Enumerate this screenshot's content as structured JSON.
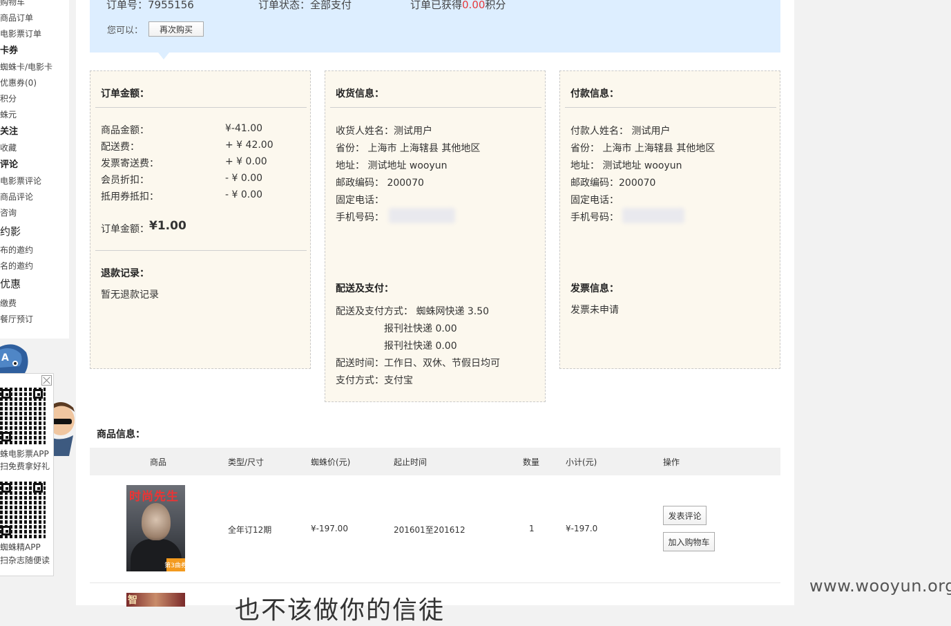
{
  "sidebar": {
    "items": [
      {
        "label": "购物车",
        "type": "item"
      },
      {
        "label": "商品订单",
        "type": "item"
      },
      {
        "label": "电影票订单",
        "type": "item"
      },
      {
        "label": "卡券",
        "type": "head"
      },
      {
        "label": "蜘蛛卡/电影卡",
        "type": "item"
      },
      {
        "label": "优惠券(0)",
        "type": "item"
      },
      {
        "label": "积分",
        "type": "item"
      },
      {
        "label": "蛛元",
        "type": "item"
      },
      {
        "label": "关注",
        "type": "head"
      },
      {
        "label": "收藏",
        "type": "item"
      },
      {
        "label": "评论",
        "type": "head"
      },
      {
        "label": "电影票评论",
        "type": "item"
      },
      {
        "label": "商品评论",
        "type": "item"
      },
      {
        "label": "咨询",
        "type": "item"
      },
      {
        "label": "约影",
        "type": "big"
      },
      {
        "label": "布的邀约",
        "type": "item"
      },
      {
        "label": "名的邀约",
        "type": "item"
      },
      {
        "label": "优惠",
        "type": "big"
      },
      {
        "label": "缴费",
        "type": "item"
      },
      {
        "label": "餐厅预订",
        "type": "item"
      }
    ]
  },
  "order_header": {
    "order_no_label": "订单号：",
    "order_no": "7955156",
    "status_label": "订单状态：",
    "status": "全部支付",
    "points_prefix": "订单已获得",
    "points": "0.00",
    "points_suffix": "积分",
    "you_can": "您可以：",
    "rebuy_button": "再次购买"
  },
  "amount_card": {
    "title": "订单金额：",
    "rows": [
      {
        "label": "商品金额：",
        "value": "¥-41.00"
      },
      {
        "label": "配送费：",
        "value": "+ ¥ 42.00"
      },
      {
        "label": "发票寄送费：",
        "value": "+ ¥ 0.00"
      },
      {
        "label": "会员折扣：",
        "value": "- ¥ 0.00"
      },
      {
        "label": "抵用券抵扣：",
        "value": "- ¥ 0.00"
      }
    ],
    "total_label": "订单金额：",
    "total": "¥1.00",
    "refund_title": "退款记录：",
    "refund_text": "暂无退款记录"
  },
  "shipping_card": {
    "title": "收货信息：",
    "rows": [
      "收货人姓名：测试用户",
      "省份： 上海市 上海辖县 其他地区",
      "地址： 测试地址 wooyun",
      "邮政编码： 200070",
      "固定电话：",
      "手机号码："
    ],
    "delivery_title": "配送及支付：",
    "delivery_rows": [
      "配送及支付方式： 蜘蛛网快递 3.50",
      "报刊社快递 0.00",
      "报刊社快递 0.00",
      "配送时间：工作日、双休、节假日均可",
      "支付方式：支付宝"
    ]
  },
  "payment_card": {
    "title": "付款信息：",
    "rows": [
      "付款人姓名： 测试用户",
      "省份： 上海市 上海辖县 其他地区",
      "地址： 测试地址 wooyun",
      "邮政编码：200070",
      "固定电话：",
      "手机号码："
    ],
    "invoice_title": "发票信息：",
    "invoice_text": "发票未申请"
  },
  "goods": {
    "title": "商品信息：",
    "columns": [
      "商品",
      "类型/尺寸",
      "蜘蛛价(元)",
      "起止时间",
      "数量",
      "小计(元)",
      "操作"
    ],
    "rows": [
      {
        "type_size": "全年订12期",
        "price": "¥-197.00",
        "period": "201601至201612",
        "qty": "1",
        "subtotal": "¥-197.0",
        "actions": [
          "发表评论",
          "加入购物车"
        ],
        "cover_title": "时尚先生",
        "cover_badge": "第3曲券"
      }
    ],
    "next_cover_glyph": "智",
    "bottom_text": "也不该做你的信徒"
  },
  "qr_widget": {
    "line1": "蛛电影票APP",
    "line2": "扫免费拿好礼",
    "line3": "蜘蛛精APP",
    "line4": "扫杂志随便读"
  },
  "watermark": "www.wooyun.org",
  "colors": {
    "accent_red": "#e4393c",
    "info_bar": "#ddeeff",
    "card_bg": "#fcf8ee"
  }
}
